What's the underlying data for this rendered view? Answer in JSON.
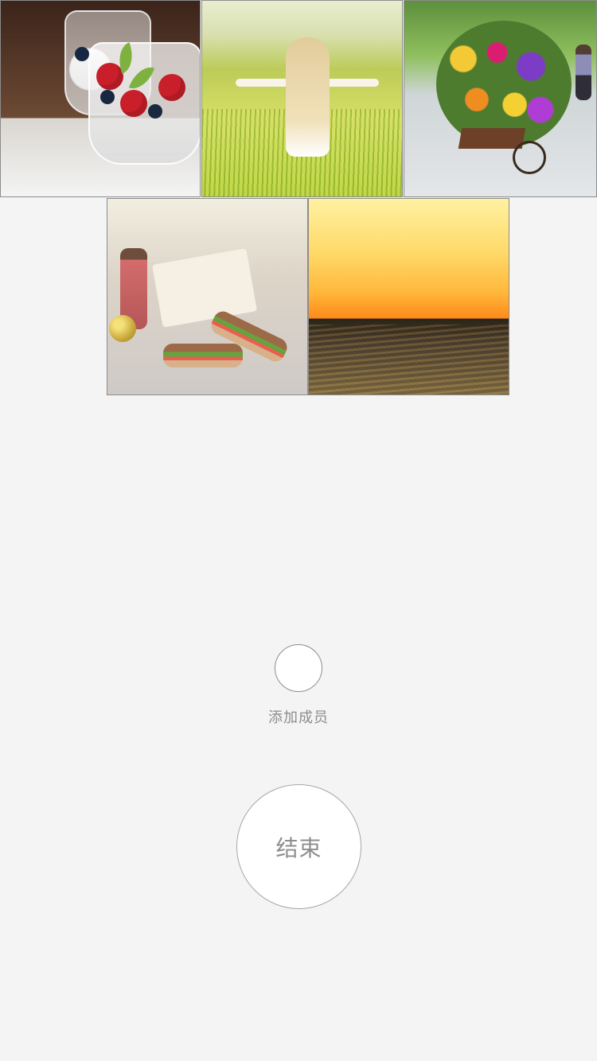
{
  "gallery": {
    "tiles": [
      {
        "name": "fruit-parfait-photo"
      },
      {
        "name": "field-woman-photo"
      },
      {
        "name": "flower-cart-photo"
      },
      {
        "name": "picnic-sandwich-photo"
      },
      {
        "name": "sunset-sea-photo"
      }
    ]
  },
  "actions": {
    "add_member_label": "添加成员",
    "end_label": "结束"
  },
  "colors": {
    "background": "#f4f4f4",
    "text": "#8c8c8c",
    "outline": "#a6a6a6"
  },
  "icons": {
    "add_member": "circle-icon",
    "end_button": "circle-button"
  }
}
